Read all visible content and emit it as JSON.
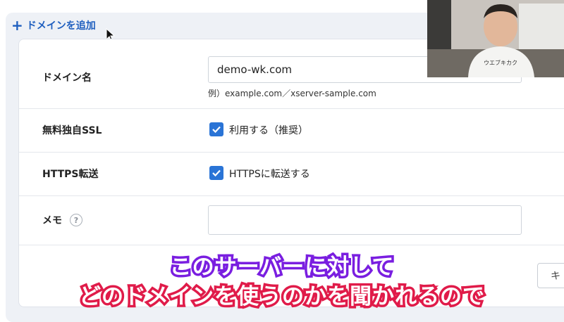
{
  "add_domain": {
    "plus": "+",
    "label": "ドメインを追加"
  },
  "form": {
    "domain": {
      "label": "ドメイン名",
      "value": "demo-wk.com",
      "hint": "例）example.com／xserver-sample.com"
    },
    "ssl": {
      "label": "無料独自SSL",
      "checkbox_label": "利用する（推奨）",
      "checked": true
    },
    "https": {
      "label": "HTTPS転送",
      "checkbox_label": "HTTPSに転送する",
      "checked": true
    },
    "memo": {
      "label": "メモ",
      "help": "?",
      "value": ""
    }
  },
  "buttons": {
    "cancel": "キ"
  },
  "webcam": {
    "shirt_text": "ウエブキカク"
  },
  "subtitles": {
    "line1": "このサーバーに対して",
    "line2": "どのドメインを使うのかを聞かれるので"
  },
  "colors": {
    "accent": "#1f5fbf",
    "checkbox": "#2a74d6",
    "subtitle_stroke_1": "#7a1fe0",
    "subtitle_stroke_2": "#e01c4a"
  }
}
